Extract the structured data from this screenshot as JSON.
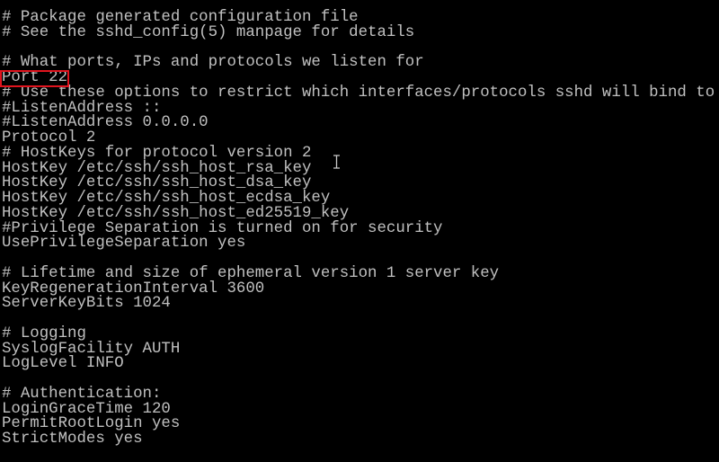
{
  "terminal": {
    "lines": [
      "# Package generated configuration file",
      "# See the sshd_config(5) manpage for details",
      "",
      "# What ports, IPs and protocols we listen for",
      "Port 22",
      "# Use these options to restrict which interfaces/protocols sshd will bind to",
      "#ListenAddress ::",
      "#ListenAddress 0.0.0.0",
      "Protocol 2",
      "# HostKeys for protocol version 2",
      "HostKey /etc/ssh/ssh_host_rsa_key",
      "HostKey /etc/ssh/ssh_host_dsa_key",
      "HostKey /etc/ssh/ssh_host_ecdsa_key",
      "HostKey /etc/ssh/ssh_host_ed25519_key",
      "#Privilege Separation is turned on for security",
      "UsePrivilegeSeparation yes",
      "",
      "# Lifetime and size of ephemeral version 1 server key",
      "KeyRegenerationInterval 3600",
      "ServerKeyBits 1024",
      "",
      "# Logging",
      "SyslogFacility AUTH",
      "LogLevel INFO",
      "",
      "# Authentication:",
      "LoginGraceTime 120",
      "PermitRootLogin yes",
      "StrictModes yes"
    ],
    "text_color": "#c0c0c0",
    "background": "#000000",
    "highlight_color": "#e0141e",
    "highlighted_line": "Port 22"
  }
}
